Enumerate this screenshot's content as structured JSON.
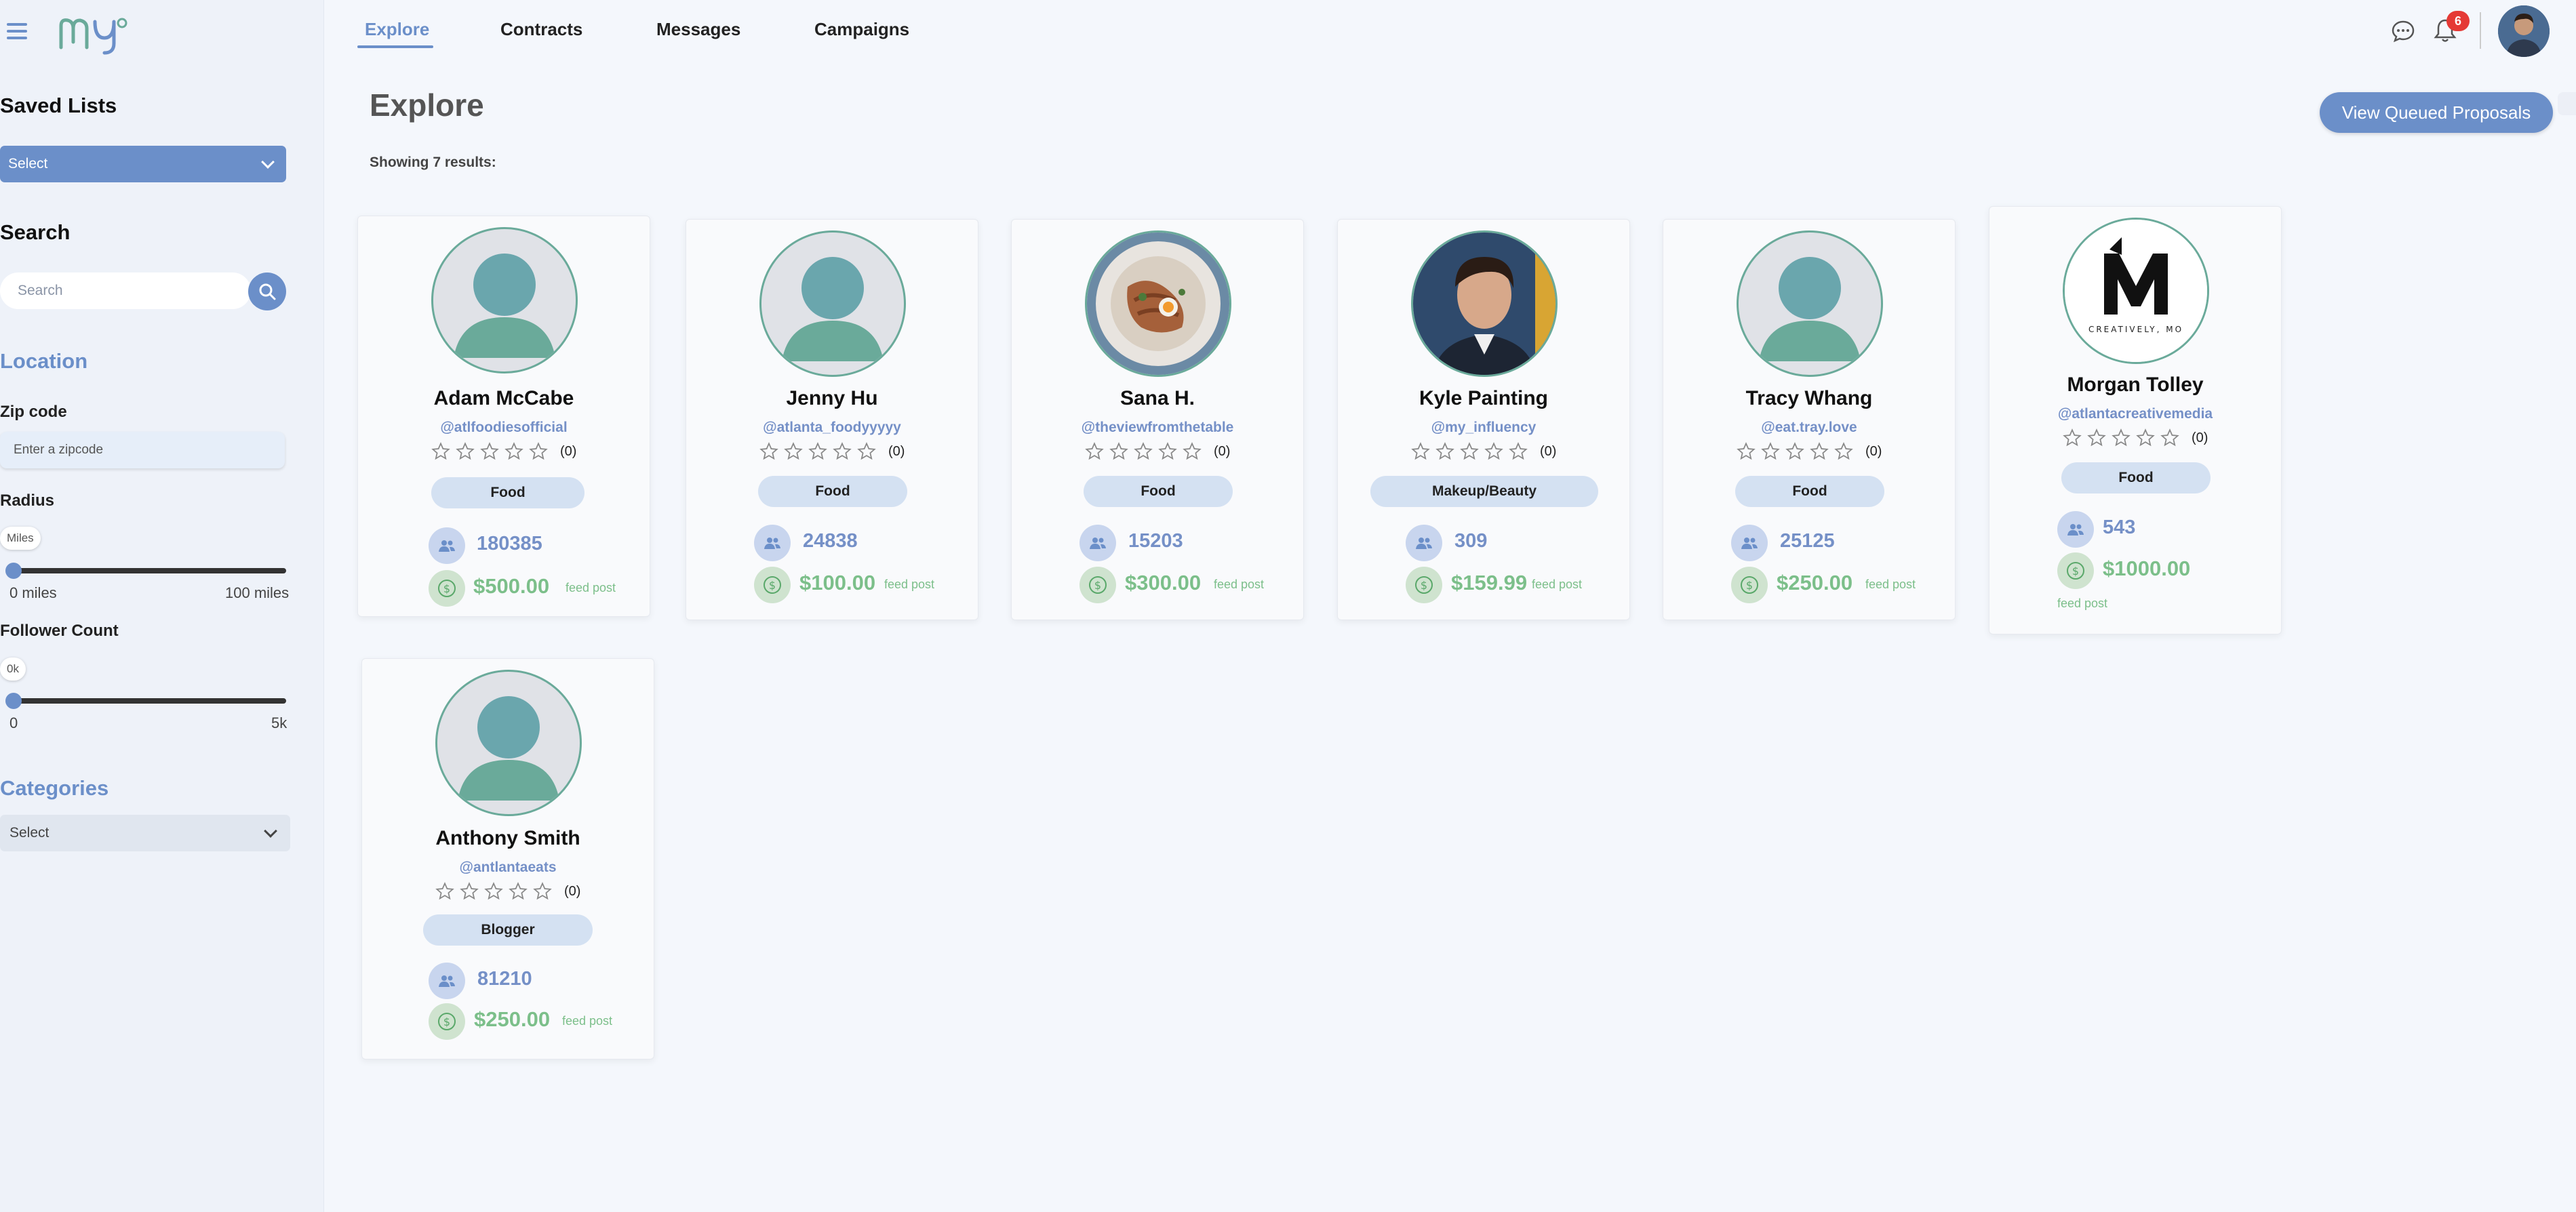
{
  "nav": {
    "tabs": [
      "Explore",
      "Contracts",
      "Messages",
      "Campaigns"
    ],
    "active_tab": "Explore",
    "notification_count": "6"
  },
  "sidebar": {
    "saved_lists": {
      "title": "Saved Lists",
      "select_value": "Select"
    },
    "search": {
      "title": "Search",
      "placeholder": "Search"
    },
    "location": {
      "title": "Location",
      "zip_label": "Zip code",
      "zip_placeholder": "Enter a zipcode",
      "radius_label": "Radius",
      "radius_unit": "Miles",
      "radius_min": "0 miles",
      "radius_max": "100 miles",
      "radius_value": 0
    },
    "followers": {
      "title": "Follower Count",
      "value_label": "0k",
      "min": "0",
      "max": "5k",
      "value": 0
    },
    "categories": {
      "title": "Categories",
      "select_value": "Select"
    }
  },
  "main": {
    "title": "Explore",
    "results_text": "Showing 7 results:",
    "queue_button": "View Queued Proposals"
  },
  "influencers": [
    {
      "name": "Adam McCabe",
      "handle": "@atlfoodiesofficial",
      "rating": "(0)",
      "stars": 0,
      "category": "Food",
      "followers": "180385",
      "price": "$500.00",
      "price_label": "feed post",
      "avatar": "default-avatar"
    },
    {
      "name": "Jenny Hu",
      "handle": "@atlanta_foodyyyyy",
      "rating": "(0)",
      "stars": 0,
      "category": "Food",
      "followers": "24838",
      "price": "$100.00",
      "price_label": "feed post",
      "avatar": "default-avatar"
    },
    {
      "name": "Sana H.",
      "handle": "@theviewfromthetable",
      "rating": "(0)",
      "stars": 0,
      "category": "Food",
      "followers": "15203",
      "price": "$300.00",
      "price_label": "feed post",
      "avatar": "food-photo"
    },
    {
      "name": "Kyle Painting",
      "handle": "@my_influency",
      "rating": "(0)",
      "stars": 0,
      "category": "Makeup/Beauty",
      "followers": "309",
      "price": "$159.99",
      "price_label": "feed post",
      "avatar": "person-photo"
    },
    {
      "name": "Tracy Whang",
      "handle": "@eat.tray.love",
      "rating": "(0)",
      "stars": 0,
      "category": "Food",
      "followers": "25125",
      "price": "$250.00",
      "price_label": "feed post",
      "avatar": "default-avatar"
    },
    {
      "name": "Morgan Tolley",
      "handle": "@atlantacreativemedia",
      "rating": "(0)",
      "stars": 0,
      "category": "Food",
      "followers": "543",
      "price": "$1000.00",
      "price_label": "feed post",
      "avatar": "brand-logo",
      "logo_text": "CREATIVELY, MO"
    },
    {
      "name": "Anthony Smith",
      "handle": "@antlantaeats",
      "rating": "(0)",
      "stars": 0,
      "category": "Blogger",
      "followers": "81210",
      "price": "$250.00",
      "price_label": "feed post",
      "avatar": "default-avatar"
    }
  ],
  "colors": {
    "accent": "#6b8fc9",
    "green": "#7cbf8a",
    "avatar_ring": "#6aaa9a",
    "badge": "#d4e1f2"
  }
}
